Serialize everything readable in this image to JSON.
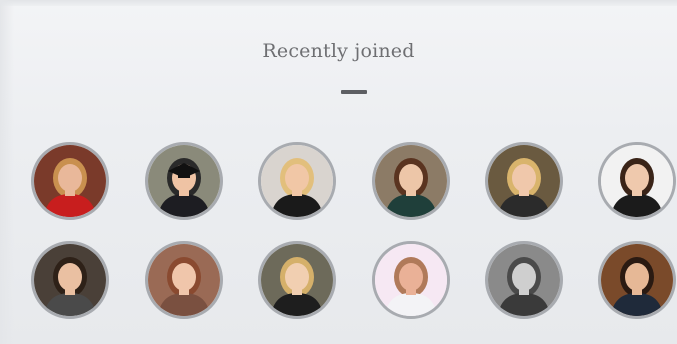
{
  "section": {
    "title": "Recently joined"
  },
  "members": {
    "row1": [
      {
        "icon": "user-photo",
        "bg": "#7a3a2a",
        "skin": "#e9b89a",
        "hair": "#c9904f",
        "top": "#c81e1e"
      },
      {
        "icon": "user-photo",
        "bg": "#8a8a7a",
        "skin": "#efc3a4",
        "hair": "#2a2a2a",
        "top": "#1d1d22",
        "cap": true
      },
      {
        "icon": "user-photo",
        "bg": "#d9d4cf",
        "skin": "#f1c7a6",
        "hair": "#e2bf7c",
        "top": "#1a1a1a"
      },
      {
        "icon": "user-photo",
        "bg": "#8c7b66",
        "skin": "#edc6a8",
        "hair": "#5a3420",
        "top": "#1f3f3a"
      },
      {
        "icon": "user-photo",
        "bg": "#6a5a40",
        "skin": "#f0c8ab",
        "hair": "#d9b46c",
        "top": "#2b2b2b"
      },
      {
        "icon": "user-photo",
        "bg": "#f2f2f2",
        "skin": "#efc9ad",
        "hair": "#3a2418",
        "top": "#1b1b1b"
      }
    ],
    "row2": [
      {
        "icon": "user-photo",
        "bg": "#4a4038",
        "skin": "#eac0a2",
        "hair": "#2e2118",
        "top": "#4a4a4a"
      },
      {
        "icon": "user-photo",
        "bg": "#9a6a55",
        "skin": "#f0c6ab",
        "hair": "#8a4a30",
        "top": "#7a5040"
      },
      {
        "icon": "user-photo",
        "bg": "#6d6a5a",
        "skin": "#f1cfb1",
        "hair": "#d5b06a",
        "top": "#1e1e1e"
      },
      {
        "icon": "user-photo",
        "bg": "#f6e8f3",
        "skin": "#eab197",
        "hair": "#b07a5a",
        "top": "#f3f3f6"
      },
      {
        "icon": "user-photo",
        "bg": "#8a8a8a",
        "skin": "#cfcfcf",
        "hair": "#4a4a4a",
        "top": "#3a3a3a"
      },
      {
        "icon": "user-photo",
        "bg": "#7a4a2a",
        "skin": "#e6b896",
        "hair": "#2a1a12",
        "top": "#1f2a3a"
      }
    ]
  }
}
